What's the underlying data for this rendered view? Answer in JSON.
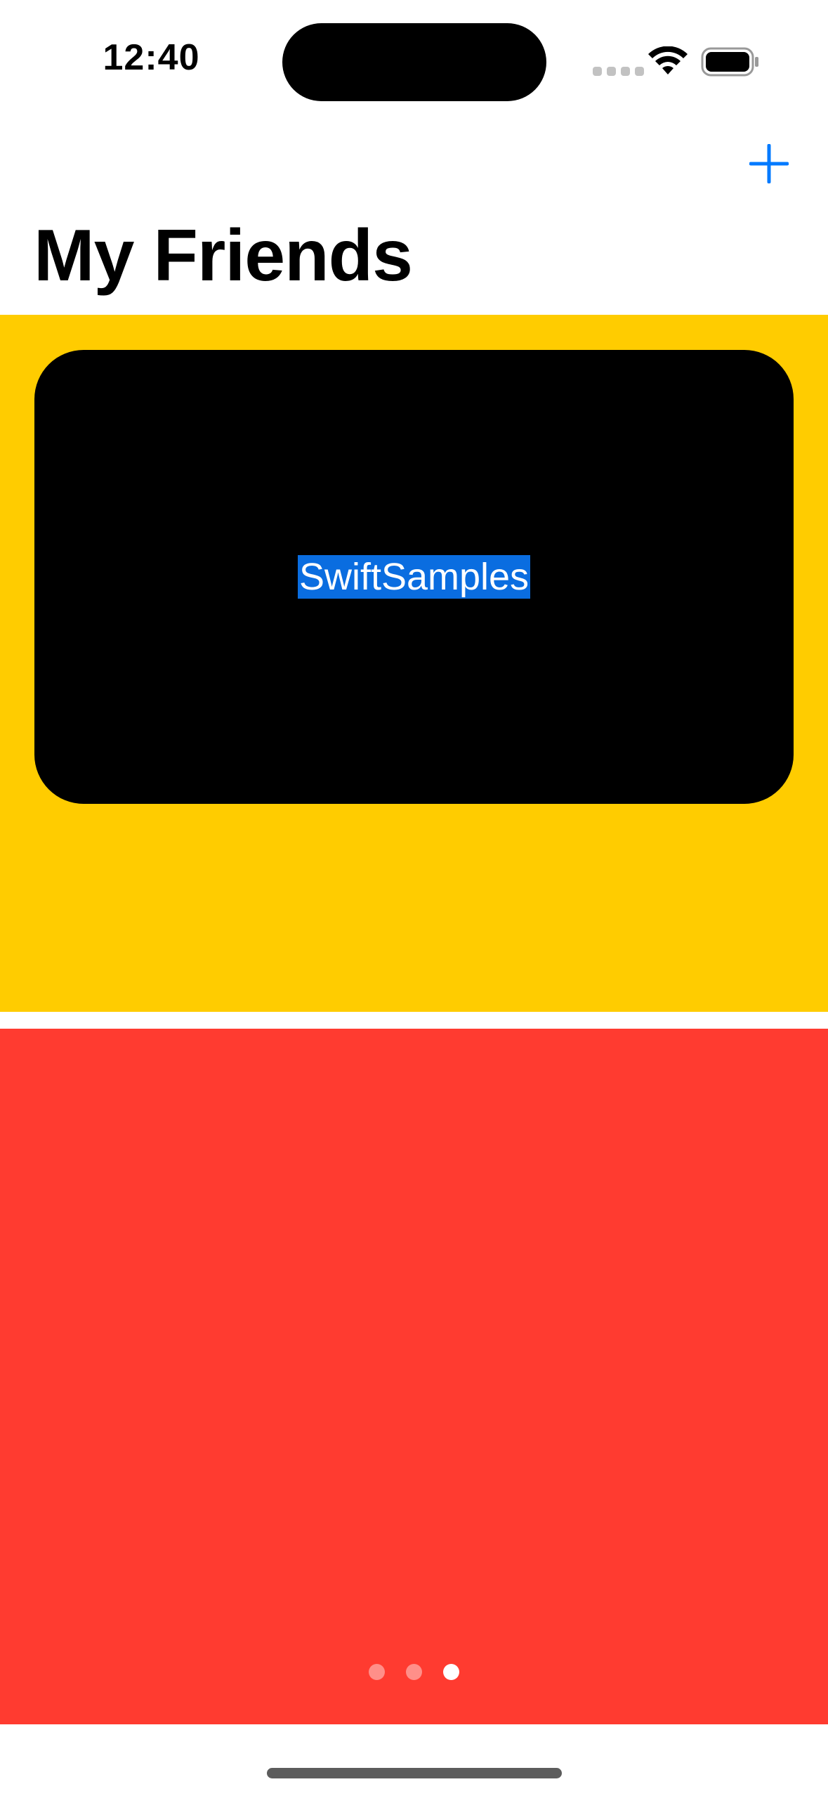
{
  "status_bar": {
    "time": "12:40",
    "wifi_icon": "wifi-icon",
    "battery_icon": "battery-icon",
    "signal_icon": "cellular-signal-icon"
  },
  "nav": {
    "add_icon": "plus-icon",
    "title": "My Friends"
  },
  "pages": {
    "card_label": "SwiftSamples",
    "count": 3,
    "current_index": 2
  },
  "colors": {
    "accent": "#007aff",
    "yellow_page": "#ffcc00",
    "red_page": "#ff3b30",
    "card": "#000000",
    "label_highlight": "#0a6de0",
    "dot_active": "#ffffff",
    "dot_inactive": "#ff8f89"
  }
}
